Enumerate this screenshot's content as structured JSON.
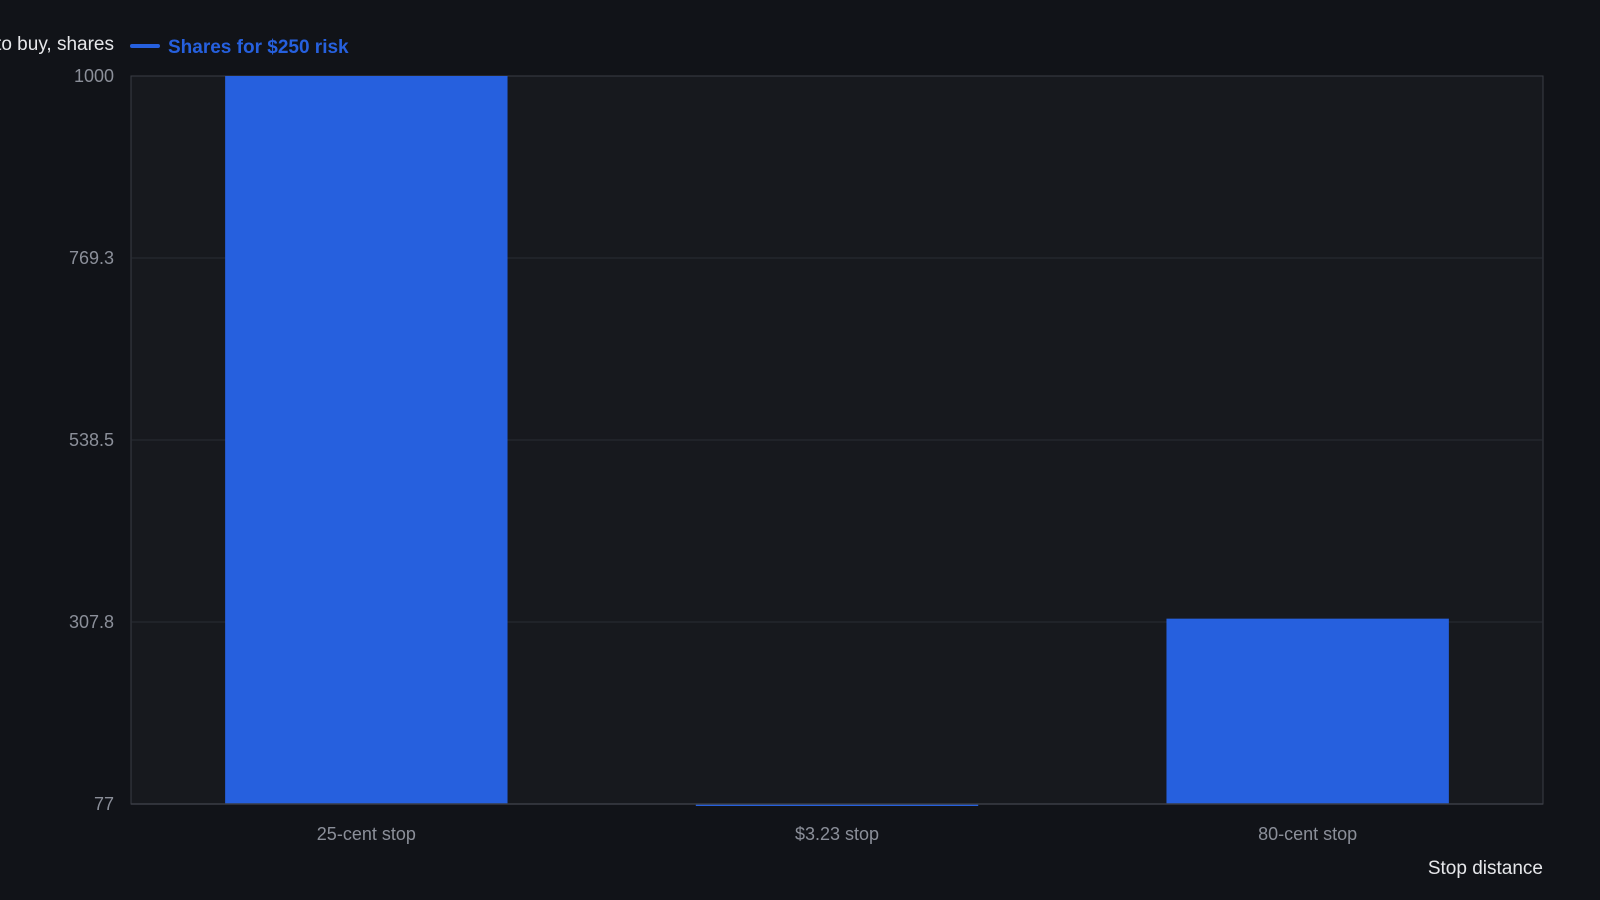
{
  "chart_data": {
    "type": "bar",
    "categories": [
      "25-cent stop",
      "$3.23 stop",
      "80-cent stop"
    ],
    "series": [
      {
        "name": "Shares for $250 risk",
        "values": [
          1000,
          77,
          312
        ],
        "color": "#2660de"
      }
    ],
    "ylabel": "Shares to buy, shares",
    "xlabel": "Stop distance",
    "ylim": [
      77,
      1000
    ],
    "yticks": [
      "1000",
      "769.3",
      "538.5",
      "307.8",
      "77"
    ],
    "legend_position": "top-left",
    "grid": true,
    "colors": {
      "background": "#111318",
      "plot_background": "#17191e",
      "grid": "#2a2d34",
      "axis": "#3a3d45"
    }
  }
}
